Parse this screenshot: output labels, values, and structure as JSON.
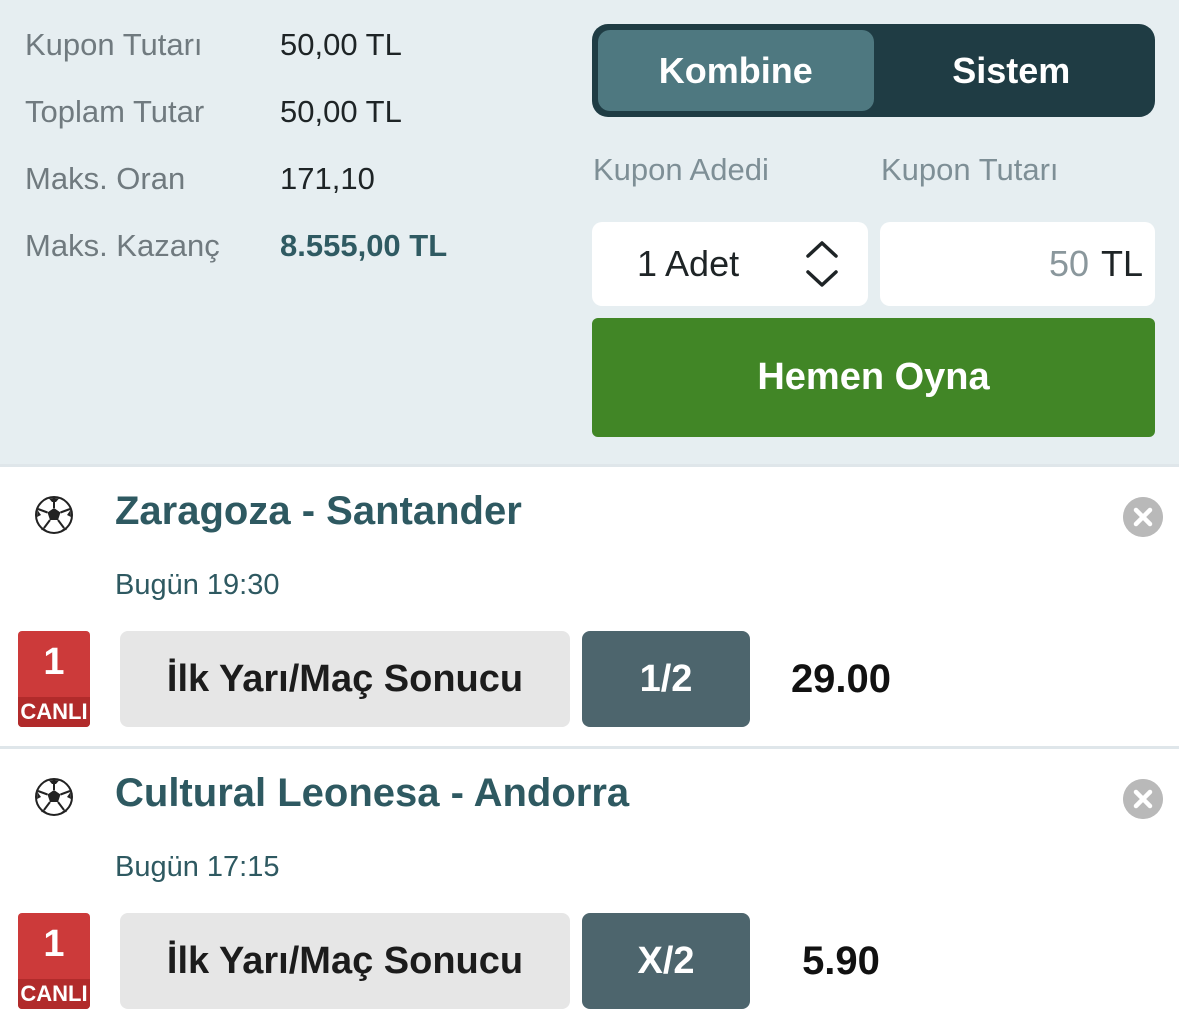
{
  "summary": {
    "rows": [
      {
        "label": "Kupon Tutarı",
        "value": "50,00 TL"
      },
      {
        "label": "Toplam Tutar",
        "value": "50,00 TL"
      },
      {
        "label": "Maks. Oran",
        "value": "171,10"
      },
      {
        "label": "Maks. Kazanç",
        "value": "8.555,00 TL"
      }
    ]
  },
  "bet_type": {
    "options": [
      "Kombine",
      "Sistem"
    ],
    "selected": "Kombine"
  },
  "coupon": {
    "count_label": "Kupon Adedi",
    "amount_label": "Kupon Tutarı",
    "count_value": "1 Adet",
    "amount_value": "50",
    "amount_unit": "TL",
    "play_button": "Hemen Oyna"
  },
  "bets": [
    {
      "match": "Zaragoza - Santander",
      "time": "Bugün 19:30",
      "live_number": "1",
      "live_label": "CANLI",
      "market": "İlk Yarı/Maç Sonucu",
      "selection": "1/2",
      "odds": "29.00"
    },
    {
      "match": "Cultural Leonesa - Andorra",
      "time": "Bugün 17:15",
      "live_number": "1",
      "live_label": "CANLI",
      "market": "İlk Yarı/Maç Sonucu",
      "selection": "X/2",
      "odds": "5.90"
    }
  ],
  "icons": {
    "sport": "soccer-ball-icon",
    "remove": "close-circle-icon",
    "stepper": "chevron-up-down-icon"
  },
  "colors": {
    "panel_bg": "#e6eef1",
    "toggle_bg": "#1f3c44",
    "toggle_active": "#4e7880",
    "play_button": "#418626",
    "live_badge": "#cc3a3a",
    "selection_bg": "#4d656d",
    "title_text": "#2e5961"
  }
}
